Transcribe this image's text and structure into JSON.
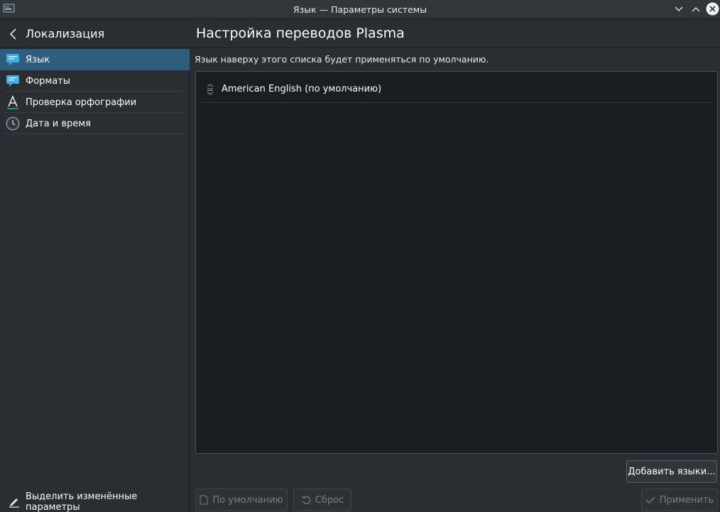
{
  "window": {
    "title": "Язык — Параметры системы",
    "icons": {
      "app": "system-settings-icon",
      "minimize": "chevron-down-icon",
      "maximize": "chevron-up-icon",
      "close": "close-icon"
    }
  },
  "sidebar": {
    "title": "Локализация",
    "items": [
      {
        "label": "Язык",
        "icon": "language-icon"
      },
      {
        "label": "Форматы",
        "icon": "formats-icon"
      },
      {
        "label": "Проверка орфографии",
        "icon": "spellcheck-icon"
      },
      {
        "label": "Дата и время",
        "icon": "clock-icon"
      }
    ],
    "active_index": 0,
    "footer_label": "Выделить изменённые параметры"
  },
  "main": {
    "title": "Настройка переводов Plasma",
    "hint": "Язык наверху этого списка будет применяться по умолчанию.",
    "languages": [
      {
        "label": "American English (по умолчанию)"
      }
    ],
    "add_label": "Добавить языки...",
    "defaults_label": "По умолчанию",
    "reset_label": "Сброс",
    "apply_label": "Применить"
  },
  "colors": {
    "accent": "#2f5d7d",
    "background": "#2a2e32",
    "list_background": "#1b1e20",
    "text": "#fcfcfc"
  }
}
